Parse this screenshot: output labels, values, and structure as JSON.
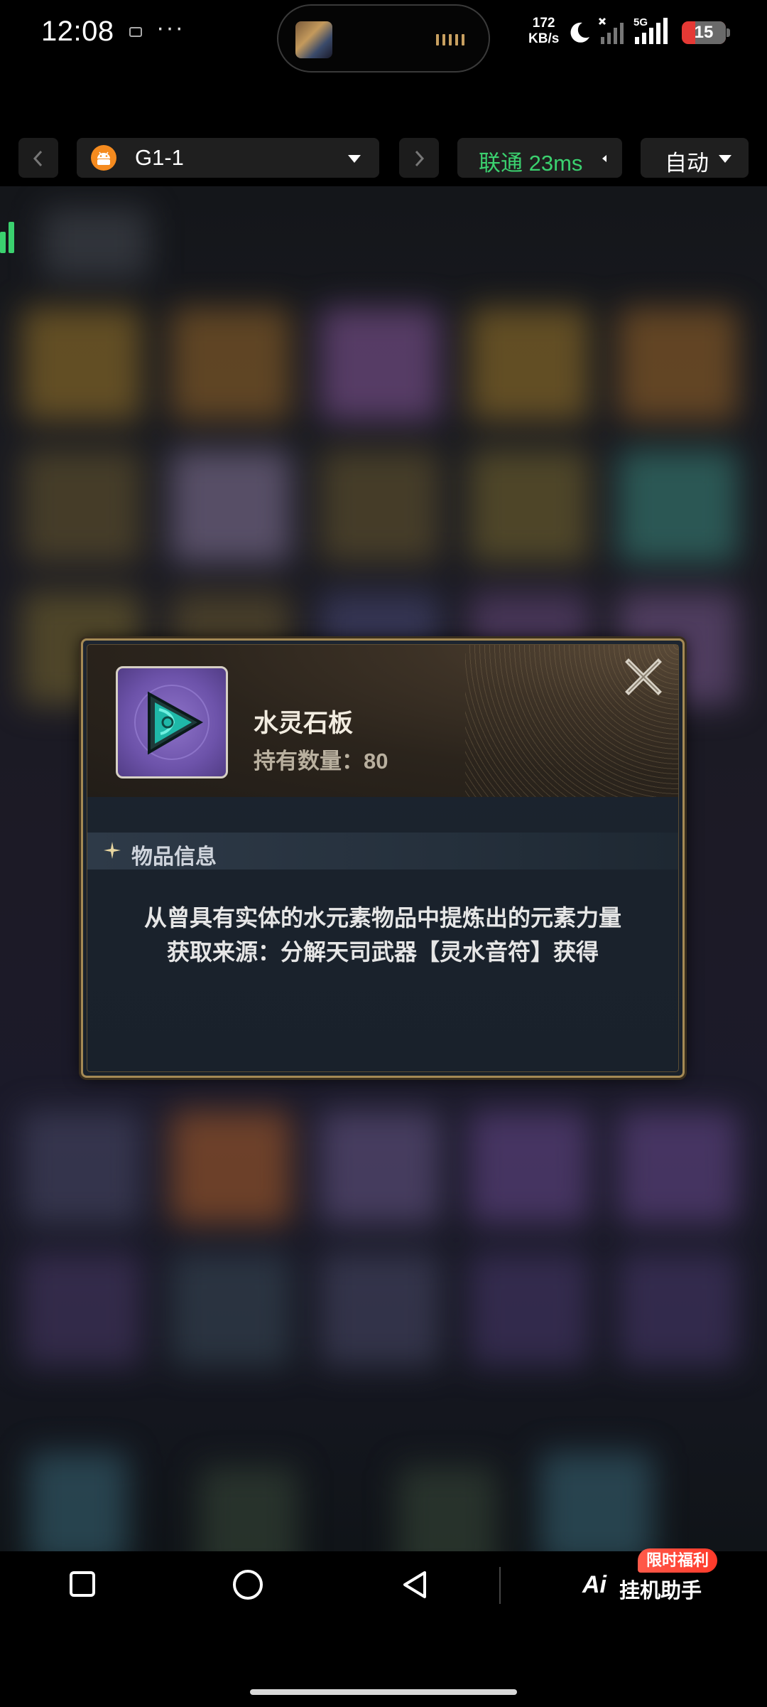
{
  "status_bar": {
    "time": "12:08",
    "net_speed_value": "172",
    "net_speed_unit": "KB/s",
    "network_type": "5G",
    "battery": "15",
    "icons": [
      "message-icon",
      "more-icon",
      "moon-icon",
      "signal-icon",
      "battery-icon"
    ]
  },
  "toolbar": {
    "device_name": "G1-1",
    "network": "联通 23ms",
    "mode": "自动"
  },
  "dialog": {
    "item_name": "水灵石板",
    "quantity_label": "持有数量：80",
    "section_title": "物品信息",
    "description_line1": "从曾具有实体的水元素物品中提炼出的元素力量",
    "description_line2": "获取来源：分解天司武器【灵水音符】获得"
  },
  "bottom_nav": {
    "assistant_logo": "Ai",
    "assistant_name": "挂机助手",
    "promo_badge": "限时福利"
  },
  "colors": {
    "accent_green": "#3bd16f",
    "battery_red": "#e53935",
    "dialog_border_gold": "#a58a55",
    "item_frame_purple": "#6d53aa",
    "promo_red": "#ff3a2a"
  }
}
